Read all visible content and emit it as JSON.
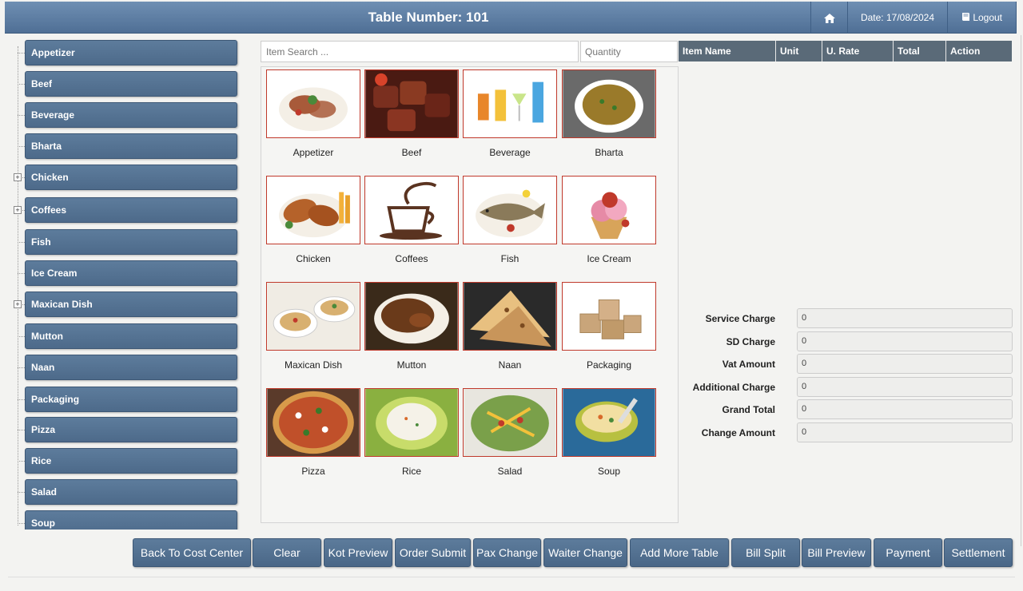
{
  "header": {
    "title": "Table Number: 101",
    "home_icon": "home-icon",
    "date": "Date: 17/08/2024",
    "logout": "Logout",
    "logout_icon": "book-icon"
  },
  "sidebar": {
    "items": [
      {
        "label": "Appetizer",
        "expandable": false
      },
      {
        "label": "Beef",
        "expandable": false
      },
      {
        "label": "Beverage",
        "expandable": false
      },
      {
        "label": "Bharta",
        "expandable": false
      },
      {
        "label": "Chicken",
        "expandable": true
      },
      {
        "label": "Coffees",
        "expandable": true
      },
      {
        "label": "Fish",
        "expandable": false
      },
      {
        "label": "Ice Cream",
        "expandable": false
      },
      {
        "label": "Maxican Dish",
        "expandable": true
      },
      {
        "label": "Mutton",
        "expandable": false
      },
      {
        "label": "Naan",
        "expandable": false
      },
      {
        "label": "Packaging",
        "expandable": false
      },
      {
        "label": "Pizza",
        "expandable": false
      },
      {
        "label": "Rice",
        "expandable": false
      },
      {
        "label": "Salad",
        "expandable": false
      },
      {
        "label": "Soup",
        "expandable": false
      }
    ]
  },
  "search": {
    "placeholder": "Item Search ...",
    "value": ""
  },
  "quantity": {
    "placeholder": "Quantity",
    "value": ""
  },
  "categories": [
    {
      "label": "Appetizer",
      "color": "#a85a3a"
    },
    {
      "label": "Beef",
      "color": "#7a2f1f"
    },
    {
      "label": "Beverage",
      "color": "#e79a3a"
    },
    {
      "label": "Bharta",
      "color": "#9a7a2a"
    },
    {
      "label": "Chicken",
      "color": "#b5622a"
    },
    {
      "label": "Coffees",
      "color": "#5a3320"
    },
    {
      "label": "Fish",
      "color": "#8a7a5a"
    },
    {
      "label": "Ice Cream",
      "color": "#e68aa6"
    },
    {
      "label": "Maxican Dish",
      "color": "#d8b070"
    },
    {
      "label": "Mutton",
      "color": "#6a3a1a"
    },
    {
      "label": "Naan",
      "color": "#c8955a"
    },
    {
      "label": "Packaging",
      "color": "#c9a57a"
    },
    {
      "label": "Pizza",
      "color": "#c0502a"
    },
    {
      "label": "Rice",
      "color": "#a8c04a"
    },
    {
      "label": "Salad",
      "color": "#7aa04a"
    },
    {
      "label": "Soup",
      "color": "#b8c040"
    }
  ],
  "order_table": {
    "columns": [
      "Item Name",
      "Unit",
      "U. Rate",
      "Total",
      "Action"
    ],
    "header_color": "#5a6a78",
    "rows": []
  },
  "charges": [
    {
      "label": "Service Charge",
      "value": "0"
    },
    {
      "label": "SD Charge",
      "value": "0"
    },
    {
      "label": "Vat Amount",
      "value": "0"
    },
    {
      "label": "Additional Charge",
      "value": "0"
    },
    {
      "label": "Grand Total",
      "value": "0"
    },
    {
      "label": "Change Amount",
      "value": "0"
    }
  ],
  "actions": [
    "Back To Cost Center",
    "Clear",
    "Kot Preview",
    "Order Submit",
    "Pax Change",
    "Waiter Change",
    "Add More Table",
    "Bill Split",
    "Bill Preview",
    "Payment",
    "Settlement"
  ]
}
